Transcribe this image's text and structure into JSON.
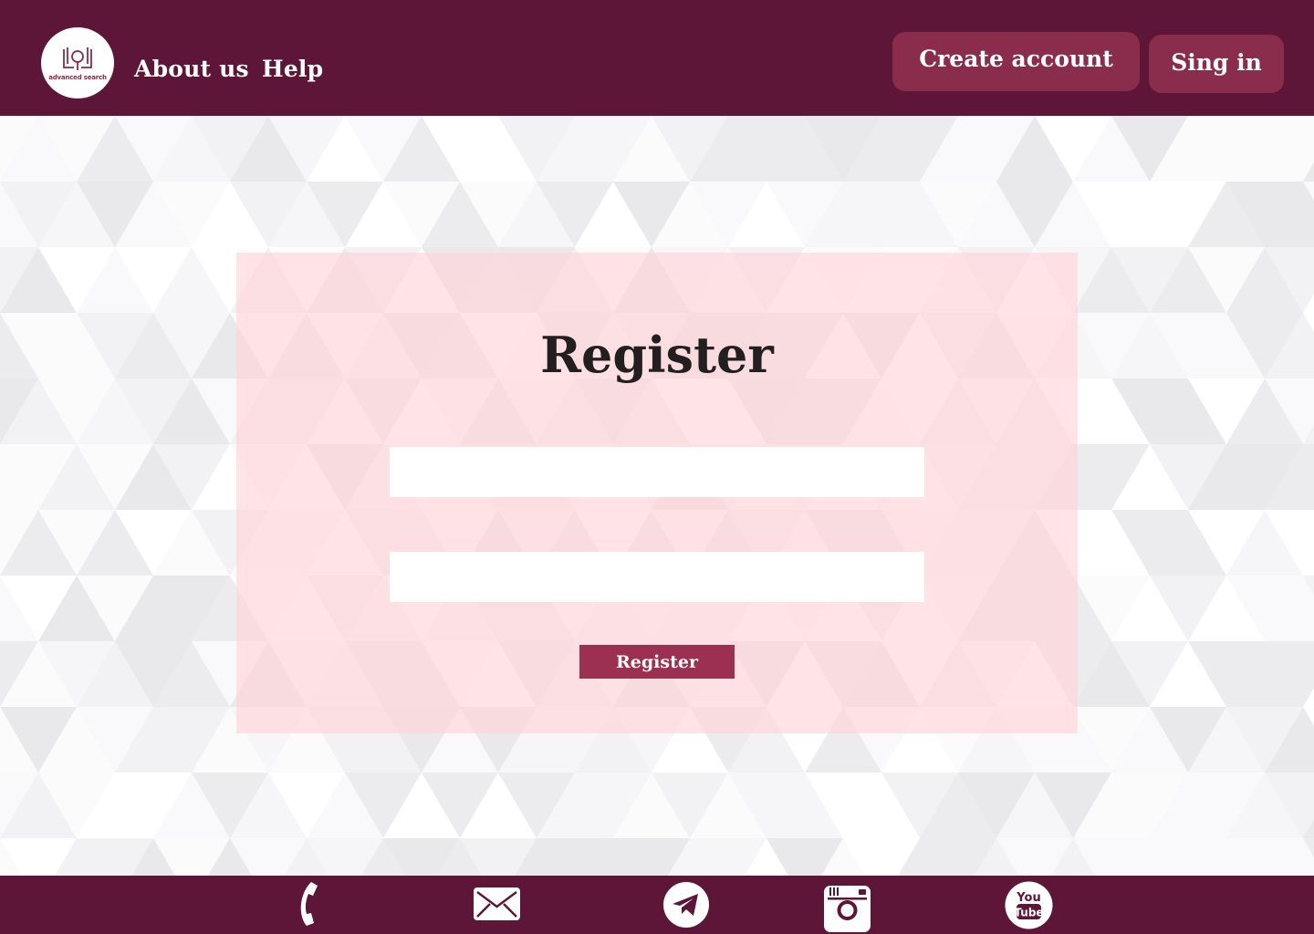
{
  "header": {
    "logo_text": "advanced search",
    "nav": [
      {
        "label": "About us"
      },
      {
        "label": "Help"
      }
    ],
    "create_account_label": "Create account",
    "sign_in_label": "Sing in"
  },
  "form": {
    "title": "Register",
    "field_1": {
      "value": "",
      "placeholder": ""
    },
    "field_2": {
      "value": "",
      "placeholder": ""
    },
    "submit_label": "Register"
  },
  "footer": {
    "icons": [
      "phone-icon",
      "mail-icon",
      "telegram-icon",
      "instagram-icon",
      "youtube-icon"
    ],
    "youtube_you": "You",
    "youtube_tube": "Tube"
  },
  "colors": {
    "header_bg": "#5e1638",
    "button_bg": "#8a2c4b",
    "register_button_bg": "#9b3052",
    "card_bg": "#fdd9dc",
    "logo_accent": "#8c2a47"
  }
}
